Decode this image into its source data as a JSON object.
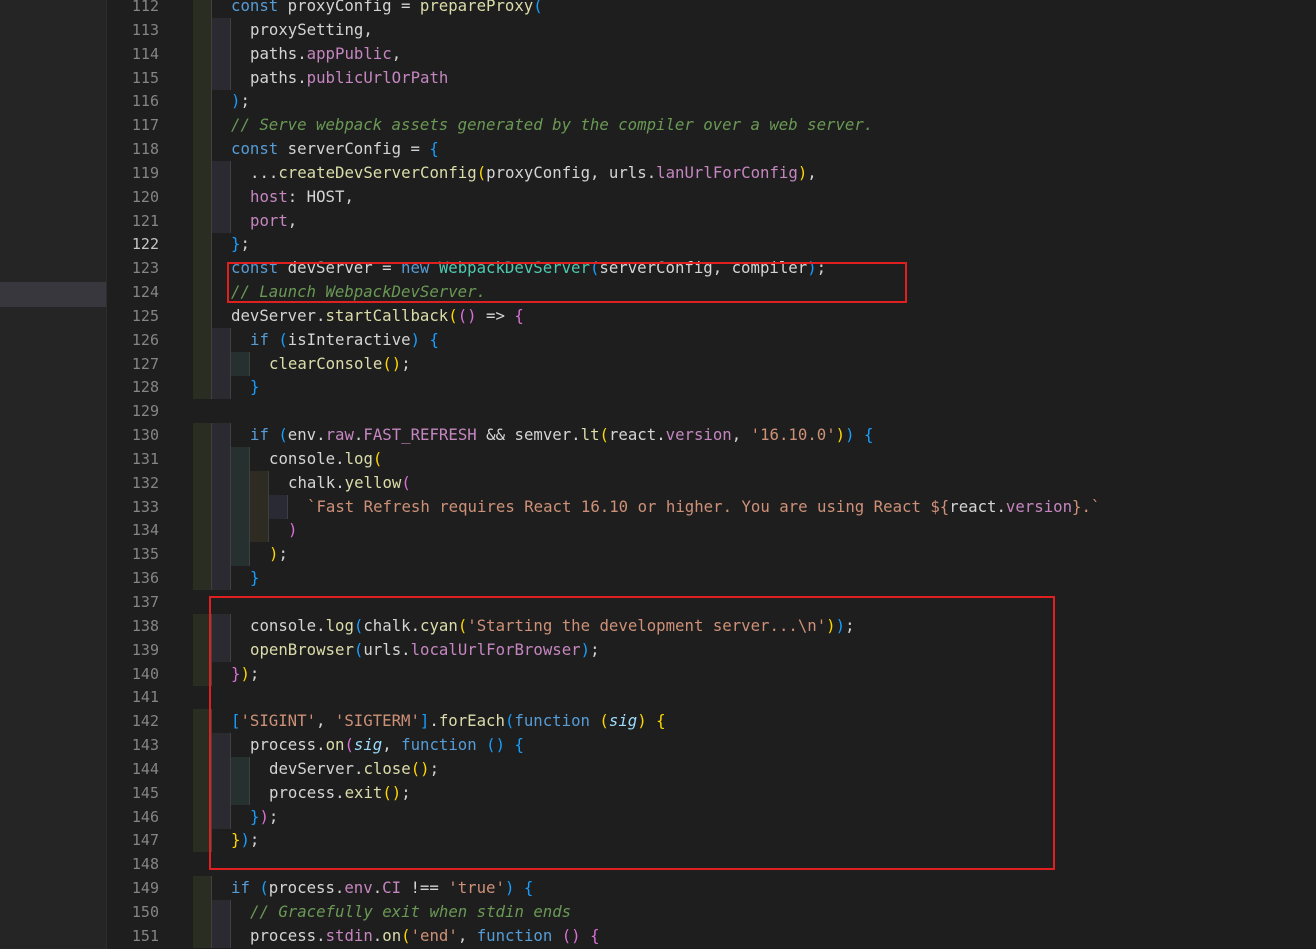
{
  "colors": {
    "keyword": "#569cd6",
    "control": "#c586c0",
    "function": "#dcdcaa",
    "variable": "#9cdcfe",
    "property": "#c586c0",
    "string": "#ce9178",
    "comment": "#6a9955",
    "plain": "#d4d4d4",
    "bracket1": "#ffd700",
    "bracket2": "#da70d6",
    "bracket3": "#179fff",
    "type": "#4ec9b0",
    "number": "#b5cea8",
    "highlight_box": "#e02020"
  },
  "editor": {
    "active_line": 122,
    "lines": [
      {
        "n": 112,
        "i": 1,
        "t": [
          [
            "k",
            "const"
          ],
          [
            "p",
            " proxyConfig = "
          ],
          [
            "f",
            "prepareProxy"
          ],
          [
            "b3",
            "("
          ]
        ]
      },
      {
        "n": 113,
        "i": 2,
        "t": [
          [
            "p",
            "proxySetting,"
          ]
        ]
      },
      {
        "n": 114,
        "i": 2,
        "t": [
          [
            "p",
            "paths."
          ],
          [
            "m",
            "appPublic"
          ],
          [
            "p",
            ","
          ]
        ]
      },
      {
        "n": 115,
        "i": 2,
        "t": [
          [
            "p",
            "paths."
          ],
          [
            "m",
            "publicUrlOrPath"
          ]
        ]
      },
      {
        "n": 116,
        "i": 1,
        "t": [
          [
            "b3",
            ")"
          ],
          [
            "p",
            ";"
          ]
        ]
      },
      {
        "n": 117,
        "i": 1,
        "t": [
          [
            "c",
            "// Serve webpack assets generated by the compiler over a web server."
          ]
        ]
      },
      {
        "n": 118,
        "i": 1,
        "t": [
          [
            "k",
            "const"
          ],
          [
            "p",
            " serverConfig = "
          ],
          [
            "b3",
            "{"
          ]
        ]
      },
      {
        "n": 119,
        "i": 2,
        "t": [
          [
            "p",
            "..."
          ],
          [
            "f",
            "createDevServerConfig"
          ],
          [
            "b1",
            "("
          ],
          [
            "p",
            "proxyConfig, urls."
          ],
          [
            "m",
            "lanUrlForConfig"
          ],
          [
            "b1",
            ")"
          ],
          [
            "p",
            ","
          ]
        ]
      },
      {
        "n": 120,
        "i": 2,
        "t": [
          [
            "m",
            "host"
          ],
          [
            "p",
            ": HOST,"
          ]
        ]
      },
      {
        "n": 121,
        "i": 2,
        "t": [
          [
            "m",
            "port"
          ],
          [
            "p",
            ","
          ]
        ]
      },
      {
        "n": 122,
        "i": 1,
        "t": [
          [
            "b3",
            "}"
          ],
          [
            "p",
            ";"
          ]
        ]
      },
      {
        "n": 123,
        "i": 1,
        "t": [
          [
            "k",
            "const"
          ],
          [
            "p",
            " devServer = "
          ],
          [
            "k",
            "new"
          ],
          [
            "p",
            " "
          ],
          [
            "ty",
            "WebpackDevServer"
          ],
          [
            "b3",
            "("
          ],
          [
            "p",
            "serverConfig, compiler"
          ],
          [
            "b3",
            ")"
          ],
          [
            "p",
            ";"
          ]
        ]
      },
      {
        "n": 124,
        "i": 1,
        "t": [
          [
            "c",
            "// Launch WebpackDevServer."
          ]
        ]
      },
      {
        "n": 125,
        "i": 1,
        "t": [
          [
            "p",
            "devServer."
          ],
          [
            "f",
            "startCallback"
          ],
          [
            "b1",
            "("
          ],
          [
            "b2",
            "("
          ],
          [
            "b2",
            ")"
          ],
          [
            "p",
            " => "
          ],
          [
            "b2",
            "{"
          ]
        ]
      },
      {
        "n": 126,
        "i": 2,
        "t": [
          [
            "k",
            "if"
          ],
          [
            "p",
            " "
          ],
          [
            "b3",
            "("
          ],
          [
            "p",
            "isInteractive"
          ],
          [
            "b3",
            ")"
          ],
          [
            "p",
            " "
          ],
          [
            "b3",
            "{"
          ]
        ]
      },
      {
        "n": 127,
        "i": 3,
        "t": [
          [
            "f",
            "clearConsole"
          ],
          [
            "b1",
            "()"
          ],
          [
            "p",
            ";"
          ]
        ]
      },
      {
        "n": 128,
        "i": 2,
        "t": [
          [
            "b3",
            "}"
          ]
        ]
      },
      {
        "n": 129,
        "i": 0,
        "t": []
      },
      {
        "n": 130,
        "i": 2,
        "t": [
          [
            "k",
            "if"
          ],
          [
            "p",
            " "
          ],
          [
            "b3",
            "("
          ],
          [
            "p",
            "env."
          ],
          [
            "m",
            "raw"
          ],
          [
            "p",
            "."
          ],
          [
            "m",
            "FAST_REFRESH"
          ],
          [
            "p",
            " && semver."
          ],
          [
            "f",
            "lt"
          ],
          [
            "b1",
            "("
          ],
          [
            "p",
            "react."
          ],
          [
            "m",
            "version"
          ],
          [
            "p",
            ", "
          ],
          [
            "s",
            "'16.10.0'"
          ],
          [
            "b1",
            ")"
          ],
          [
            "b3",
            ")"
          ],
          [
            "p",
            " "
          ],
          [
            "b3",
            "{"
          ]
        ]
      },
      {
        "n": 131,
        "i": 3,
        "t": [
          [
            "p",
            "console."
          ],
          [
            "f",
            "log"
          ],
          [
            "b1",
            "("
          ]
        ]
      },
      {
        "n": 132,
        "i": 4,
        "t": [
          [
            "p",
            "chalk."
          ],
          [
            "f",
            "yellow"
          ],
          [
            "b2",
            "("
          ]
        ]
      },
      {
        "n": 133,
        "i": 5,
        "t": [
          [
            "s",
            "`Fast Refresh requires React 16.10 or higher. You are using React ${"
          ],
          [
            "p",
            "react."
          ],
          [
            "m",
            "version"
          ],
          [
            "s",
            "}.`"
          ]
        ]
      },
      {
        "n": 134,
        "i": 4,
        "t": [
          [
            "b2",
            ")"
          ]
        ]
      },
      {
        "n": 135,
        "i": 3,
        "t": [
          [
            "b1",
            ")"
          ],
          [
            "p",
            ";"
          ]
        ]
      },
      {
        "n": 136,
        "i": 2,
        "t": [
          [
            "b3",
            "}"
          ]
        ]
      },
      {
        "n": 137,
        "i": 0,
        "t": []
      },
      {
        "n": 138,
        "i": 2,
        "t": [
          [
            "p",
            "console."
          ],
          [
            "f",
            "log"
          ],
          [
            "b3",
            "("
          ],
          [
            "p",
            "chalk."
          ],
          [
            "f",
            "cyan"
          ],
          [
            "b1",
            "("
          ],
          [
            "s",
            "'Starting the development server...\\n'"
          ],
          [
            "b1",
            ")"
          ],
          [
            "b3",
            ")"
          ],
          [
            "p",
            ";"
          ]
        ]
      },
      {
        "n": 139,
        "i": 2,
        "t": [
          [
            "f",
            "openBrowser"
          ],
          [
            "b3",
            "("
          ],
          [
            "p",
            "urls."
          ],
          [
            "m",
            "localUrlForBrowser"
          ],
          [
            "b3",
            ")"
          ],
          [
            "p",
            ";"
          ]
        ]
      },
      {
        "n": 140,
        "i": 1,
        "t": [
          [
            "b2",
            "}"
          ],
          [
            "b1",
            ")"
          ],
          [
            "p",
            ";"
          ]
        ]
      },
      {
        "n": 141,
        "i": 0,
        "t": []
      },
      {
        "n": 142,
        "i": 1,
        "t": [
          [
            "b3",
            "["
          ],
          [
            "s",
            "'SIGINT'"
          ],
          [
            "p",
            ", "
          ],
          [
            "s",
            "'SIGTERM'"
          ],
          [
            "b3",
            "]"
          ],
          [
            "p",
            "."
          ],
          [
            "f",
            "forEach"
          ],
          [
            "b3",
            "("
          ],
          [
            "k",
            "function"
          ],
          [
            "p",
            " "
          ],
          [
            "b1",
            "("
          ],
          [
            "iv",
            "sig"
          ],
          [
            "b1",
            ")"
          ],
          [
            "p",
            " "
          ],
          [
            "b1",
            "{"
          ]
        ]
      },
      {
        "n": 143,
        "i": 2,
        "t": [
          [
            "p",
            "process."
          ],
          [
            "f",
            "on"
          ],
          [
            "b2",
            "("
          ],
          [
            "iv",
            "sig"
          ],
          [
            "p",
            ", "
          ],
          [
            "k",
            "function"
          ],
          [
            "p",
            " "
          ],
          [
            "b3",
            "()"
          ],
          [
            "p",
            " "
          ],
          [
            "b3",
            "{"
          ]
        ]
      },
      {
        "n": 144,
        "i": 3,
        "t": [
          [
            "p",
            "devServer."
          ],
          [
            "f",
            "close"
          ],
          [
            "b1",
            "()"
          ],
          [
            "p",
            ";"
          ]
        ]
      },
      {
        "n": 145,
        "i": 3,
        "t": [
          [
            "p",
            "process."
          ],
          [
            "f",
            "exit"
          ],
          [
            "b1",
            "()"
          ],
          [
            "p",
            ";"
          ]
        ]
      },
      {
        "n": 146,
        "i": 2,
        "t": [
          [
            "b3",
            "}"
          ],
          [
            "b2",
            ")"
          ],
          [
            "p",
            ";"
          ]
        ]
      },
      {
        "n": 147,
        "i": 1,
        "t": [
          [
            "b1",
            "}"
          ],
          [
            "b3",
            ")"
          ],
          [
            "p",
            ";"
          ]
        ]
      },
      {
        "n": 148,
        "i": 0,
        "t": []
      },
      {
        "n": 149,
        "i": 1,
        "t": [
          [
            "k",
            "if"
          ],
          [
            "p",
            " "
          ],
          [
            "b3",
            "("
          ],
          [
            "p",
            "process."
          ],
          [
            "m",
            "env"
          ],
          [
            "p",
            "."
          ],
          [
            "m",
            "CI"
          ],
          [
            "p",
            " !== "
          ],
          [
            "s",
            "'true'"
          ],
          [
            "b3",
            ")"
          ],
          [
            "p",
            " "
          ],
          [
            "b3",
            "{"
          ]
        ]
      },
      {
        "n": 150,
        "i": 2,
        "t": [
          [
            "c",
            "// Gracefully exit when stdin ends"
          ]
        ]
      },
      {
        "n": 151,
        "i": 2,
        "t": [
          [
            "p",
            "process."
          ],
          [
            "m",
            "stdin"
          ],
          [
            "p",
            "."
          ],
          [
            "f",
            "on"
          ],
          [
            "b1",
            "("
          ],
          [
            "s",
            "'end'"
          ],
          [
            "p",
            ", "
          ],
          [
            "k",
            "function"
          ],
          [
            "p",
            " "
          ],
          [
            "b2",
            "()"
          ],
          [
            "p",
            " "
          ],
          [
            "b2",
            "{"
          ]
        ]
      }
    ]
  }
}
